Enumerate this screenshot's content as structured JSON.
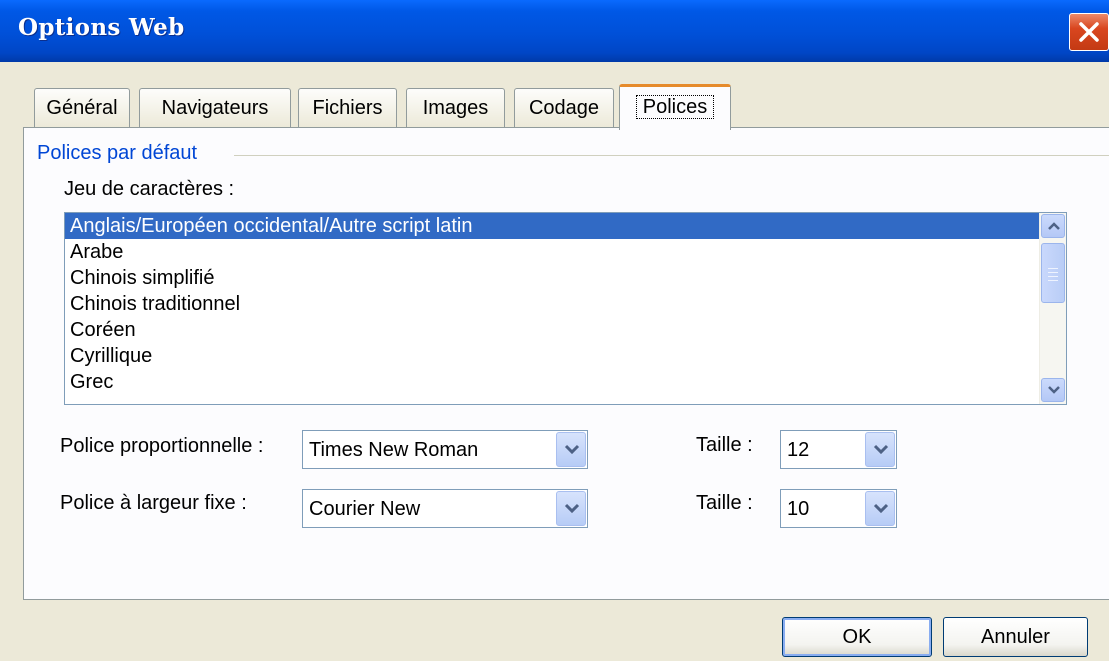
{
  "window": {
    "title": "Options Web"
  },
  "tabs": [
    {
      "label": "Général",
      "active": false
    },
    {
      "label": "Navigateurs",
      "active": false
    },
    {
      "label": "Fichiers",
      "active": false
    },
    {
      "label": "Images",
      "active": false
    },
    {
      "label": "Codage",
      "active": false
    },
    {
      "label": "Polices",
      "active": true
    }
  ],
  "group": {
    "title": "Polices par défaut"
  },
  "charset": {
    "label": "Jeu de caractères :",
    "items": [
      "Anglais/Européen occidental/Autre script latin",
      "Arabe",
      "Chinois simplifié",
      "Chinois traditionnel",
      "Coréen",
      "Cyrillique",
      "Grec"
    ],
    "selected": "Anglais/Européen occidental/Autre script latin"
  },
  "proportional": {
    "label": "Police proportionnelle :",
    "value": "Times New Roman",
    "size_label": "Taille :",
    "size_value": "12"
  },
  "fixed": {
    "label": "Police à largeur fixe :",
    "value": "Courier New",
    "size_label": "Taille :",
    "size_value": "10"
  },
  "buttons": {
    "ok": "OK",
    "cancel": "Annuler"
  },
  "colors": {
    "titlebar": "#0054e3",
    "selection": "#316ac5",
    "group_title": "#0046d5",
    "active_tab_accent": "#e68b2c",
    "close_button": "#d9461f"
  }
}
